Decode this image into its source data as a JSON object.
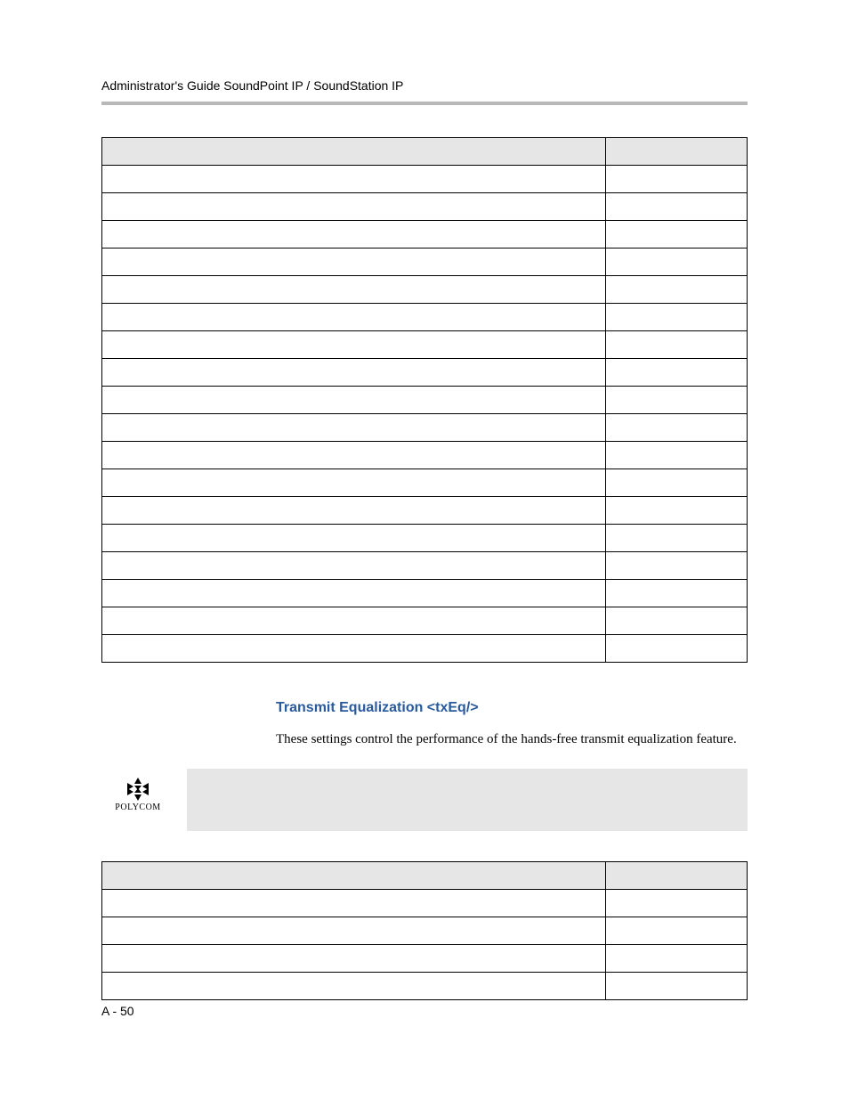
{
  "header": {
    "running_title": "Administrator's Guide SoundPoint IP / SoundStation IP"
  },
  "tables": {
    "table1": {
      "rows": 18,
      "col1": [
        "",
        "",
        "",
        "",
        "",
        "",
        "",
        "",
        "",
        "",
        "",
        "",
        "",
        "",
        "",
        "",
        "",
        ""
      ],
      "col2": [
        "",
        "",
        "",
        "",
        "",
        "",
        "",
        "",
        "",
        "",
        "",
        "",
        "",
        "",
        "",
        "",
        "",
        ""
      ]
    },
    "table2": {
      "rows": 4,
      "col1": [
        "",
        "",
        "",
        ""
      ],
      "col2": [
        "",
        "",
        "",
        ""
      ]
    }
  },
  "section": {
    "title": "Transmit Equalization <txEq/>",
    "body": "These settings control the performance of the hands-free transmit equalization feature."
  },
  "note": {
    "logo_label": "POLYCOM",
    "body": ""
  },
  "footer": {
    "page": "A - 50"
  }
}
